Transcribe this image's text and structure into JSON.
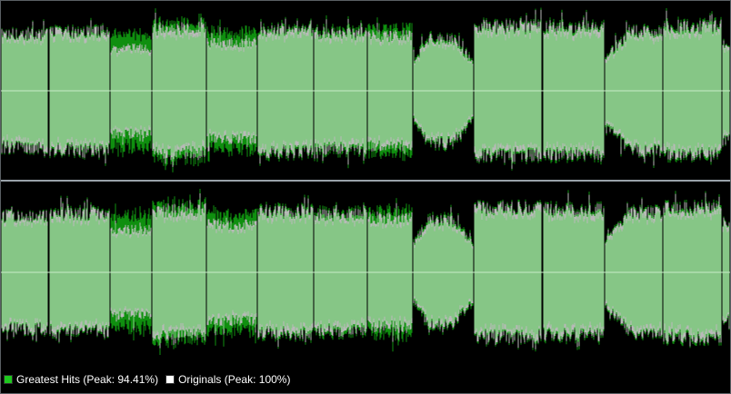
{
  "legend": {
    "greatest_hits": {
      "label": "Greatest Hits (Peak: 94.41%)",
      "color": "#1ec81e"
    },
    "originals": {
      "label": "Originals (Peak: 100%)",
      "color": "#ffffff"
    }
  },
  "colors": {
    "background": "#000000",
    "greatest_hits_waveform": "#0f8f0f",
    "originals_waveform": "#b9b9b9",
    "overlap_waveform": "#86c686",
    "center_line": "#c8ecc8",
    "divider": "#9aa3aa"
  },
  "channels": [
    "left-channel",
    "right-channel"
  ],
  "track_count": 14
}
